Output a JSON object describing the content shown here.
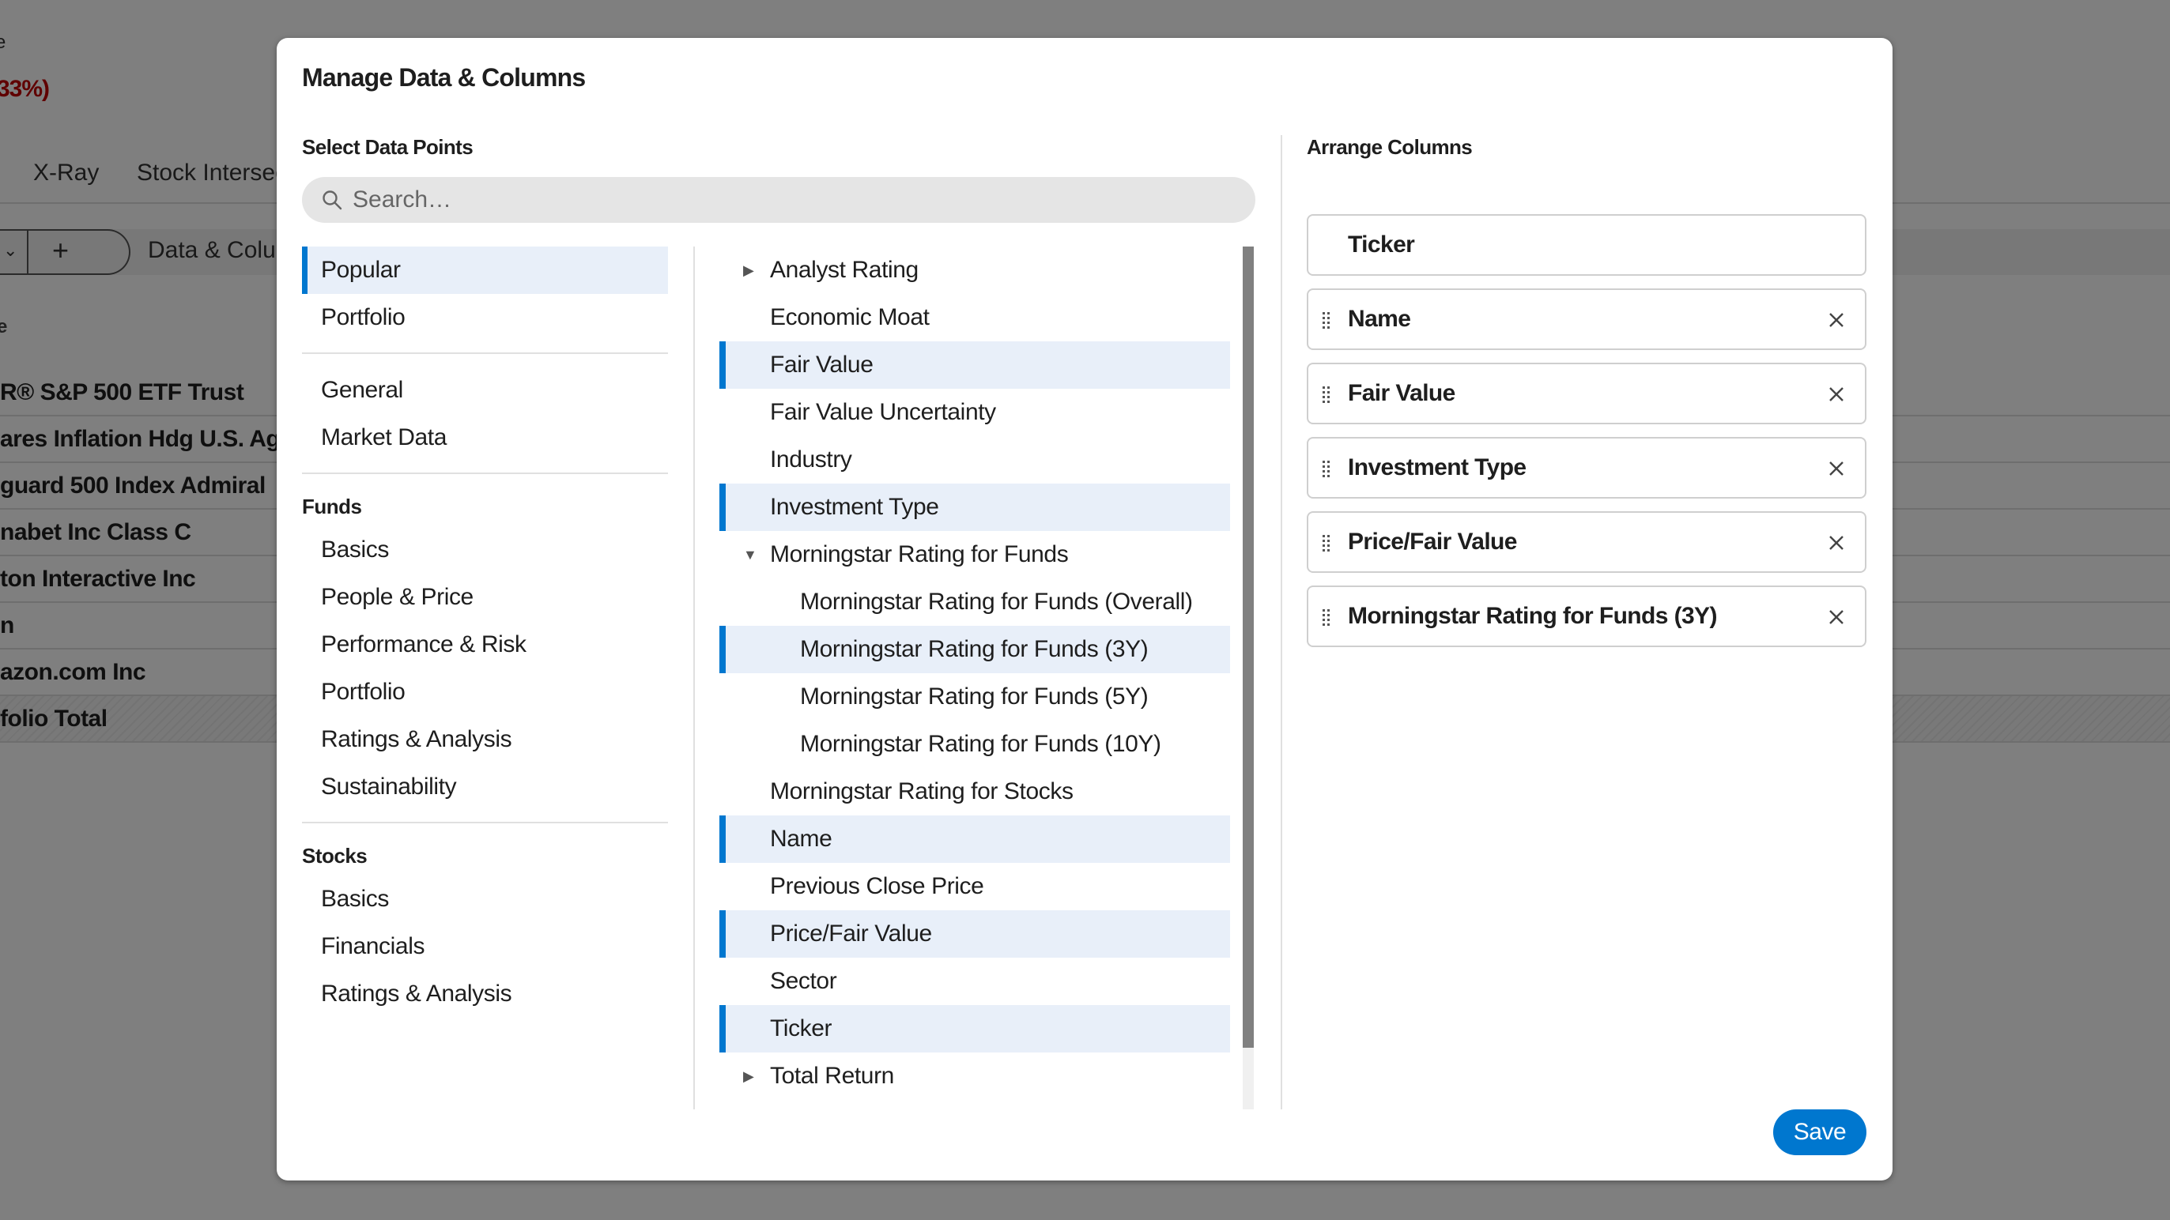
{
  "background": {
    "partial_top_char": "e",
    "change_text": "33%)",
    "tabs": [
      "X-Ray",
      "Stock Intersecti"
    ],
    "toolbar": {
      "dropdown_fragment": "a",
      "add_label": "+",
      "data_columns_label": "Data & Colum"
    },
    "column_header_fragment": "e",
    "rows": [
      "R® S&P 500 ETF Trust",
      "ares Inflation Hdg U.S. Aggt B",
      "guard 500 Index Admiral",
      "nabet Inc Class C",
      "ton Interactive Inc",
      "n",
      "azon.com Inc",
      "folio Total"
    ]
  },
  "modal": {
    "title": "Manage Data & Columns",
    "select_label": "Select Data Points",
    "search_placeholder": "Search…",
    "categories": {
      "top": [
        {
          "label": "Popular",
          "active": true
        },
        {
          "label": "Portfolio",
          "active": false
        }
      ],
      "general": [
        {
          "label": "General"
        },
        {
          "label": "Market Data"
        }
      ],
      "funds_label": "Funds",
      "funds": [
        {
          "label": "Basics"
        },
        {
          "label": "People & Price"
        },
        {
          "label": "Performance & Risk"
        },
        {
          "label": "Portfolio"
        },
        {
          "label": "Ratings & Analysis"
        },
        {
          "label": "Sustainability"
        }
      ],
      "stocks_label": "Stocks",
      "stocks": [
        {
          "label": "Basics"
        },
        {
          "label": "Financials"
        },
        {
          "label": "Ratings & Analysis"
        }
      ]
    },
    "data_points": [
      {
        "label": "Analyst Rating",
        "expander": "collapsed",
        "selected": false,
        "sub": false
      },
      {
        "label": "Economic Moat",
        "selected": false,
        "sub": false
      },
      {
        "label": "Fair Value",
        "selected": true,
        "sub": false
      },
      {
        "label": "Fair Value Uncertainty",
        "selected": false,
        "sub": false
      },
      {
        "label": "Industry",
        "selected": false,
        "sub": false
      },
      {
        "label": "Investment Type",
        "selected": true,
        "sub": false
      },
      {
        "label": "Morningstar Rating for Funds",
        "expander": "expanded",
        "selected": false,
        "sub": false
      },
      {
        "label": "Morningstar Rating for Funds (Overall)",
        "selected": false,
        "sub": true
      },
      {
        "label": "Morningstar Rating for Funds (3Y)",
        "selected": true,
        "sub": true
      },
      {
        "label": "Morningstar Rating for Funds (5Y)",
        "selected": false,
        "sub": true
      },
      {
        "label": "Morningstar Rating for Funds (10Y)",
        "selected": false,
        "sub": true
      },
      {
        "label": "Morningstar Rating for Stocks",
        "selected": false,
        "sub": false
      },
      {
        "label": "Name",
        "selected": true,
        "sub": false
      },
      {
        "label": "Previous Close Price",
        "selected": false,
        "sub": false
      },
      {
        "label": "Price/Fair Value",
        "selected": true,
        "sub": false
      },
      {
        "label": "Sector",
        "selected": false,
        "sub": false
      },
      {
        "label": "Ticker",
        "selected": true,
        "sub": false
      },
      {
        "label": "Total Return",
        "expander": "collapsed",
        "selected": false,
        "sub": false
      }
    ],
    "arrange_label": "Arrange Columns",
    "columns": [
      {
        "label": "Ticker",
        "fixed": true
      },
      {
        "label": "Name",
        "fixed": false
      },
      {
        "label": "Fair Value",
        "fixed": false
      },
      {
        "label": "Investment Type",
        "fixed": false
      },
      {
        "label": "Price/Fair Value",
        "fixed": false
      },
      {
        "label": "Morningstar Rating for Funds (3Y)",
        "fixed": false
      }
    ],
    "save_label": "Save"
  },
  "colors": {
    "accent": "#0077cf",
    "selected_bg": "#e8eff9",
    "negative": "#c00000"
  }
}
